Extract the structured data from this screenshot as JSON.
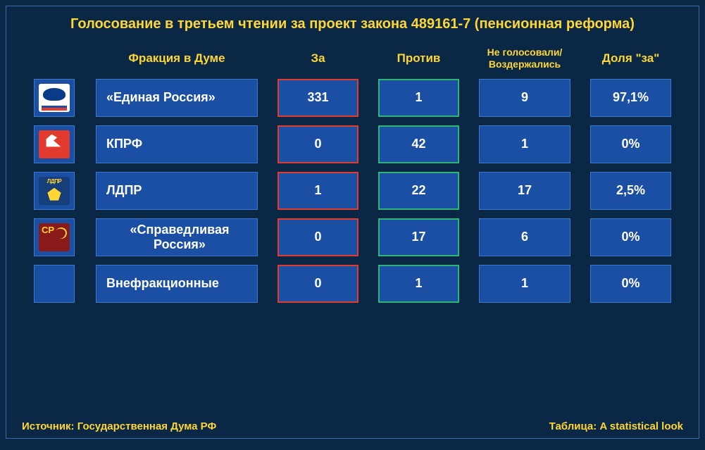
{
  "title": "Голосование в третьем чтении за проект закона 489161-7 (пенсионная реформа)",
  "headers": {
    "party": "Фракция в Думе",
    "for": "За",
    "against": "Против",
    "abstain": "Не голосовали/Воздержались",
    "share": "Доля \"за\""
  },
  "rows": [
    {
      "logo": "er",
      "name": "«Единая Россия»",
      "for": "331",
      "against": "1",
      "abstain": "9",
      "share": "97,1%"
    },
    {
      "logo": "kprf",
      "name": "КПРФ",
      "for": "0",
      "against": "42",
      "abstain": "1",
      "share": "0%"
    },
    {
      "logo": "ldpr",
      "name": "ЛДПР",
      "for": "1",
      "against": "22",
      "abstain": "17",
      "share": "2,5%"
    },
    {
      "logo": "sr",
      "name": "«Справедливая Россия»",
      "for": "0",
      "against": "17",
      "abstain": "6",
      "share": "0%"
    },
    {
      "logo": "",
      "name": "Внефракционные",
      "for": "0",
      "against": "1",
      "abstain": "1",
      "share": "0%"
    }
  ],
  "footer": {
    "source": "Источник: Государственная Дума РФ",
    "credit": "Таблица: A statistical look"
  },
  "chart_data": {
    "type": "table",
    "title": "Голосование в третьем чтении за проект закона 489161-7 (пенсионная реформа)",
    "columns": [
      "Фракция в Думе",
      "За",
      "Против",
      "Не голосовали/Воздержались",
      "Доля \"за\""
    ],
    "rows": [
      [
        "«Единая Россия»",
        331,
        1,
        9,
        "97,1%"
      ],
      [
        "КПРФ",
        0,
        42,
        1,
        "0%"
      ],
      [
        "ЛДПР",
        1,
        22,
        17,
        "2,5%"
      ],
      [
        "«Справедливая Россия»",
        0,
        17,
        6,
        "0%"
      ],
      [
        "Внефракционные",
        0,
        1,
        1,
        "0%"
      ]
    ]
  }
}
